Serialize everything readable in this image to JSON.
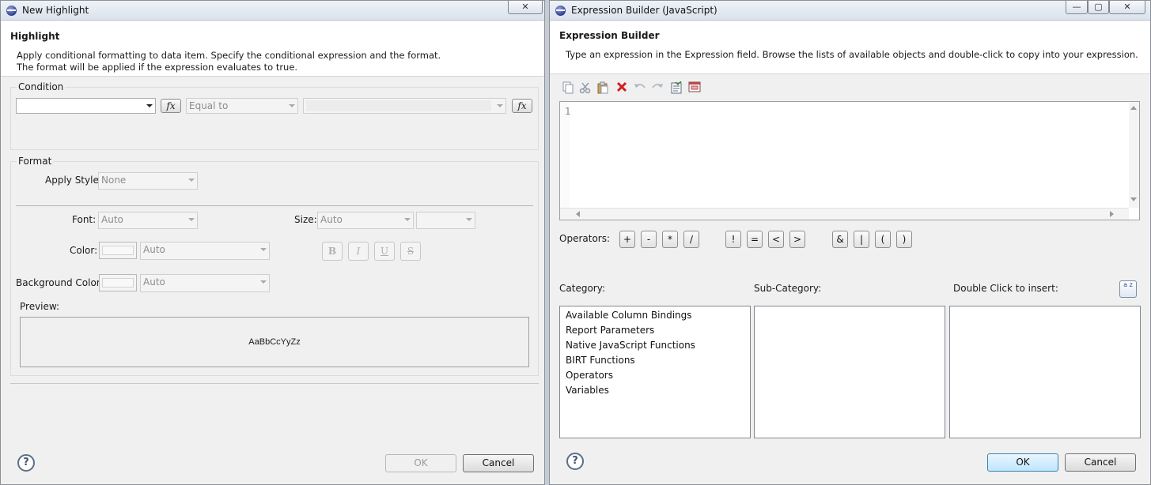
{
  "left_dialog": {
    "title": "New Highlight",
    "banner_title": "Highlight",
    "banner_lines": [
      "Apply conditional formatting to data item. Specify the conditional expression and the format.",
      "The format will be applied if the expression evaluates to true."
    ],
    "condition": {
      "label": "Condition",
      "expression_value": "",
      "fx_label": "fx",
      "operator_value": "Equal to",
      "operand_value": ""
    },
    "format": {
      "label": "Format",
      "apply_style_label": "Apply Style:",
      "apply_style_value": "None",
      "font_label": "Font:",
      "font_value": "Auto",
      "size_label": "Size:",
      "size_value": "Auto",
      "size_unit_value": "",
      "color_label": "Color:",
      "color_value": "Auto",
      "bg_color_label": "Background Color:",
      "bg_color_value": "Auto",
      "style_buttons": [
        "B",
        "I",
        "U",
        "S"
      ],
      "preview_label": "Preview:",
      "preview_text": "AaBbCcYyZz"
    },
    "help_symbol": "?",
    "ok_label": "OK",
    "cancel_label": "Cancel",
    "close_symbol": "✕"
  },
  "right_dialog": {
    "title": "Expression Builder (JavaScript)",
    "banner_title": "Expression Builder",
    "banner_msg": "Type an expression in the Expression field. Browse the lists of available objects and double-click to copy into your expression.",
    "toolbar_icons": [
      "copy-icon",
      "cut-icon",
      "paste-icon",
      "delete-icon",
      "undo-icon",
      "redo-icon",
      "validate-icon",
      "calendar-icon"
    ],
    "editor": {
      "line_number": "1",
      "content": ""
    },
    "operators_label": "Operators:",
    "operator_groups": [
      [
        "+",
        "-",
        "*",
        "/"
      ],
      [
        "!",
        "=",
        "<",
        ">"
      ],
      [
        "&",
        "|",
        "(",
        ")"
      ]
    ],
    "category_label": "Category:",
    "subcategory_label": "Sub-Category:",
    "insert_label": "Double Click to insert:",
    "categories": [
      "Available Column Bindings",
      "Report Parameters",
      "Native JavaScript Functions",
      "BIRT Functions",
      "Operators",
      "Variables"
    ],
    "sort_icon_text": "a z",
    "help_symbol": "?",
    "ok_label": "OK",
    "cancel_label": "Cancel",
    "minimize_symbol": "—",
    "maximize_symbol": "▢",
    "close_symbol": "✕"
  }
}
